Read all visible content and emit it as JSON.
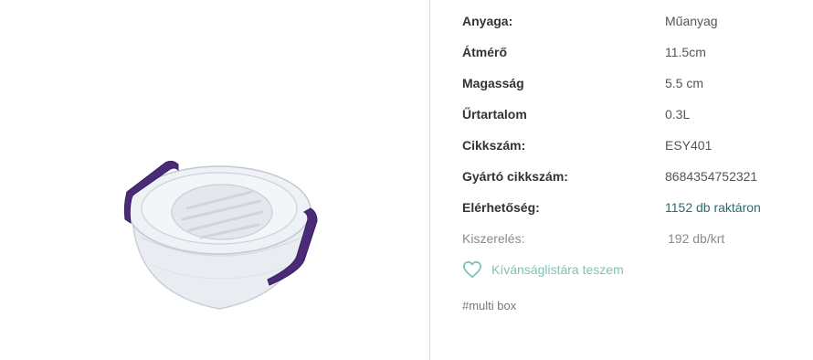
{
  "product_image": {
    "alt": "round plastic food container with purple clip handles"
  },
  "specs": [
    {
      "label": "Anyaga:",
      "value": "Műanyag"
    },
    {
      "label": "Átmérő",
      "value": "11.5cm"
    },
    {
      "label": "Magasság",
      "value": "5.5 cm"
    },
    {
      "label": "Űrtartalom",
      "value": "0.3L"
    },
    {
      "label": "Cikkszám:",
      "value": "ESY401"
    },
    {
      "label": "Gyártó cikkszám:",
      "value": "8684354752321"
    },
    {
      "label": "Elérhetőség:",
      "value": "1152 db raktáron"
    },
    {
      "label": "Kiszerelés:",
      "value": "192 db/krt"
    }
  ],
  "wishlist": {
    "label": "Kívánságlistára teszem",
    "icon": "heart-outline-icon"
  },
  "tag": {
    "label": "#multi box"
  },
  "colors": {
    "accent": "#7fc3b6",
    "stock": "#2b6b6b",
    "handle": "#4b2a7a"
  }
}
